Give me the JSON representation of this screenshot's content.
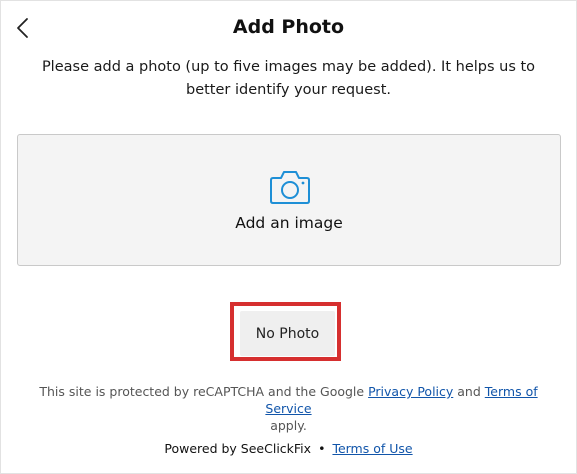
{
  "header": {
    "title": "Add Photo",
    "back_icon": "chevron-left-icon"
  },
  "intro_text": "Please add a photo (up to five images may be added). It helps us to better identify your request.",
  "dropzone": {
    "icon": "camera-icon",
    "label": "Add an image",
    "accent_color": "#1e8fd6"
  },
  "no_photo_button": {
    "label": "No Photo",
    "highlight_color": "#d62f2f"
  },
  "recaptcha": {
    "prefix": "This site is protected by reCAPTCHA and the Google",
    "privacy_link": "Privacy Policy",
    "and": "and",
    "terms_link": "Terms of Service",
    "suffix": "apply."
  },
  "footer": {
    "powered_by": "Powered by SeeClickFix",
    "separator": "•",
    "terms_link": "Terms of Use"
  }
}
